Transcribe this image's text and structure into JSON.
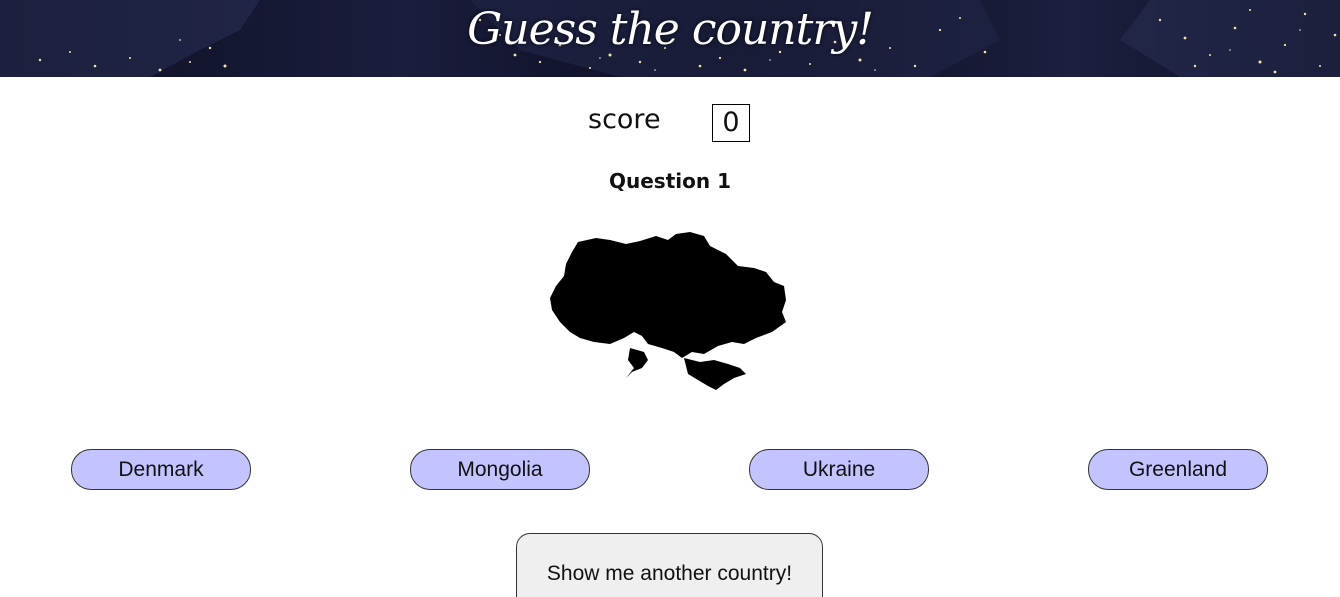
{
  "header": {
    "title": "Guess the country!"
  },
  "score": {
    "label": "score",
    "value": "0"
  },
  "question": {
    "label": "Question 1"
  },
  "answers": [
    {
      "label": "Denmark"
    },
    {
      "label": "Mongolia"
    },
    {
      "label": "Ukraine"
    },
    {
      "label": "Greenland"
    }
  ],
  "actions": {
    "another_label": "Show me another country!"
  },
  "colors": {
    "answer_button_bg": "#c3c3ff",
    "another_button_bg": "#efefef",
    "banner_bg": "#0d0f22"
  }
}
